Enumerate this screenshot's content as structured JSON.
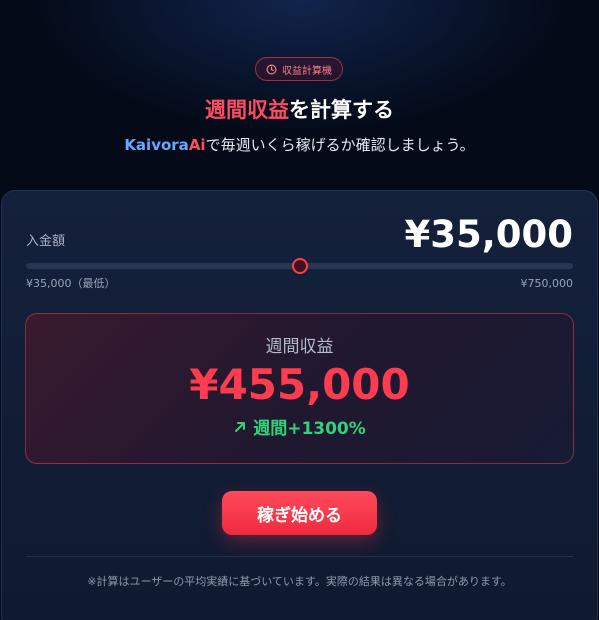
{
  "badge": {
    "icon": "clock-icon",
    "label": "収益計算機"
  },
  "heading": {
    "highlight": "週間収益",
    "rest": "を計算する"
  },
  "subheading": {
    "brand_part1": "Kaivora",
    "brand_part2": "Ai",
    "text": "で毎週いくら稼げるか確認しましょう。"
  },
  "calculator": {
    "deposit_label": "入金額",
    "deposit_value": "¥35,000",
    "slider": {
      "position_fraction": 0.5
    },
    "range_min": "¥35,000（最低）",
    "range_max": "¥750,000"
  },
  "result": {
    "label": "週間収益",
    "value": "¥455,000",
    "growth_icon": "trend-up-arrow-icon",
    "growth": "週間+1300%"
  },
  "cta": {
    "label": "稼ぎ始める"
  },
  "disclaimer": "※計算はユーザーの平均実績に基づいています。実際の結果は異なる場合があります。",
  "colors": {
    "accent": "#ff3b4f",
    "brand_blue": "#6aa8ff",
    "positive": "#33d17a",
    "background": "#040a18",
    "card": "#14213b"
  }
}
